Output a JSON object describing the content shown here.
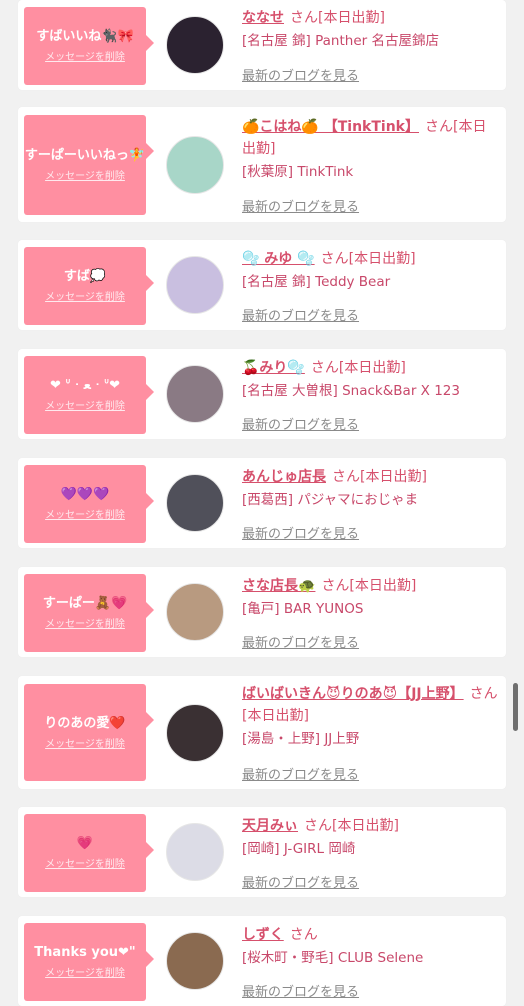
{
  "delete_label": "メッセージを削除",
  "blog_label": "最新のブログを見る",
  "cards": [
    {
      "message": "すばいいね🐈‍⬛🎀",
      "name": "ななせ",
      "suffix": "さん[本日出勤]",
      "shop": "[名古屋 錦] Panther 名古屋錦店",
      "avatar_color": "#2b2230"
    },
    {
      "message": "すーぱーいいねっ🧚",
      "name": "🍊こはね🍊 【TinkTink】",
      "suffix": "さん[本日出勤]",
      "shop": "[秋葉原] TinkTink",
      "avatar_color": "#a8d6c8"
    },
    {
      "message": "すば💭",
      "name": "🫧 みゆ 🫧",
      "suffix": "さん[本日出勤]",
      "shop": "[名古屋 錦] Teddy Bear",
      "avatar_color": "#c9bfe0"
    },
    {
      "message": "❤︎ ᐡ ᐧ ﻌ ᐧ ᐡ❤︎",
      "name": "🍒みり🫧",
      "suffix": "さん[本日出勤]",
      "shop": "[名古屋 大曽根] Snack&Bar X 123",
      "avatar_color": "#8a7a84"
    },
    {
      "message": "💜💜💜",
      "name": "あんじゅ店長",
      "suffix": "さん[本日出勤]",
      "shop": "[西葛西] パジャマにおじゃま",
      "avatar_color": "#50505a"
    },
    {
      "message": "すーぱー🧸💗",
      "name": "さな店長🐢",
      "suffix": "さん[本日出勤]",
      "shop": "[亀戸] BAR YUNOS",
      "avatar_color": "#b89a80"
    },
    {
      "message": "りのあの愛❤️",
      "name": "ばいばいきん😈りのあ😈【JJ上野】",
      "suffix": "さん[本日出勤]",
      "shop": "[湯島・上野] JJ上野",
      "avatar_color": "#3a3033"
    },
    {
      "message": "💗",
      "name": "天月みぃ",
      "suffix": "さん[本日出勤]",
      "shop": "[岡崎] J-GIRL 岡崎",
      "avatar_color": "#dcdce6"
    },
    {
      "message": "Thanks you❤︎\"",
      "name": "しずく",
      "suffix": "さん",
      "shop": "[桜木町・野毛] CLUB Selene",
      "avatar_color": "#8a6a50"
    }
  ]
}
